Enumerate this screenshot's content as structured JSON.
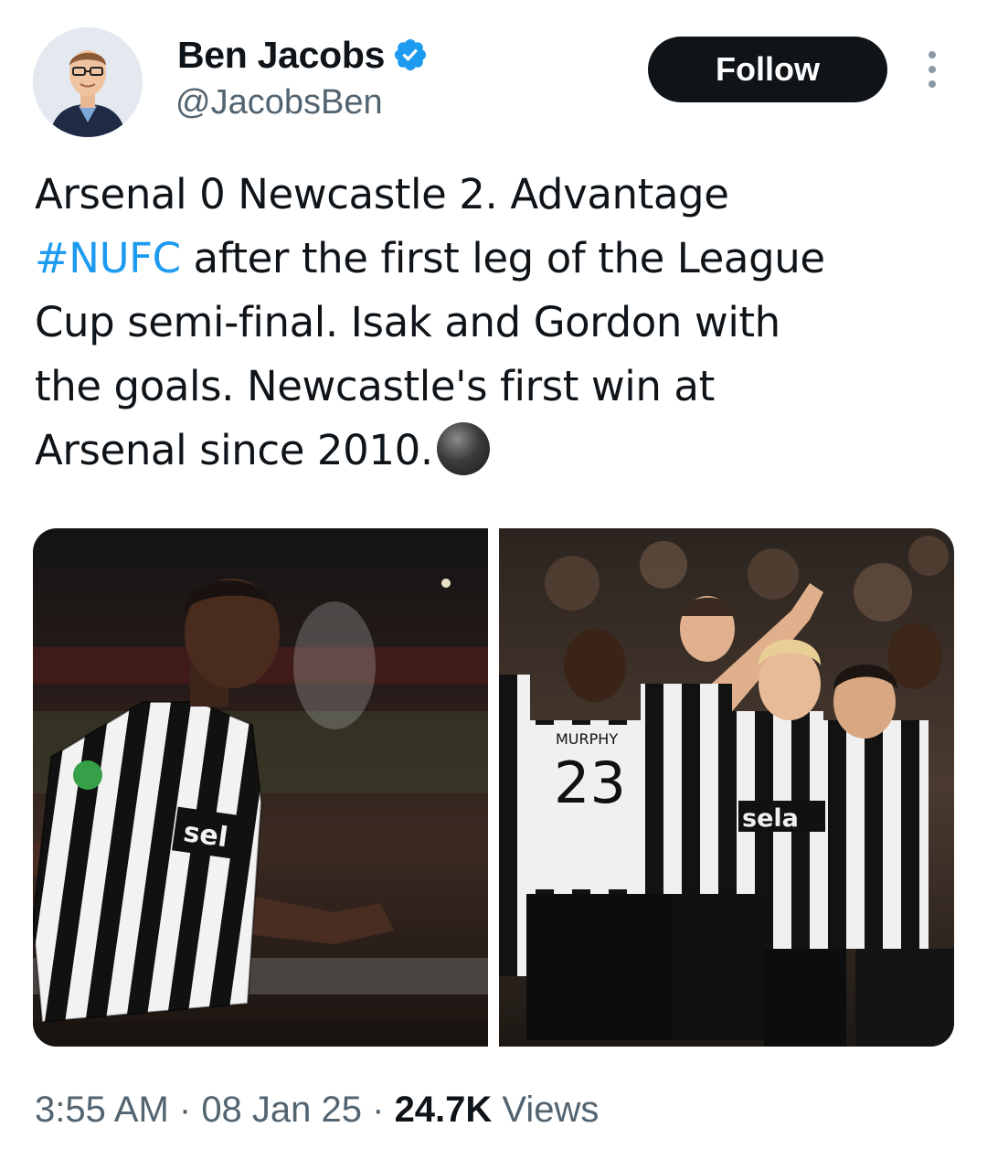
{
  "author": {
    "name": "Ben Jacobs",
    "handle": "@JacobsBen",
    "verified": true
  },
  "actions": {
    "follow_label": "Follow",
    "more_icon": "more-vertical-icon"
  },
  "tweet": {
    "line1": "Arsenal 0 Newcastle 2. Advantage",
    "hashtag": "#NUFC",
    "line2_rest": " after the first leg of the League",
    "line3": "Cup semi-final. Isak and Gordon with",
    "line4": "the goals. Newcastle's first win at",
    "line5": "Arsenal since 2010.",
    "emoji": "black-circle-emoji"
  },
  "media": {
    "photos": [
      {
        "jersey_text": "sel"
      },
      {
        "jersey_name": "MURPHY",
        "jersey_number": "23",
        "sponsor": "sela"
      }
    ]
  },
  "footer": {
    "time": "3:55 AM",
    "sep1": " · ",
    "date": "08 Jan 25",
    "sep2": " · ",
    "views_count": "24.7K",
    "views_label": " Views"
  },
  "colors": {
    "accent": "#1d9bf0",
    "text": "#0f1419",
    "secondary": "#536471",
    "button_bg": "#0f1419"
  }
}
